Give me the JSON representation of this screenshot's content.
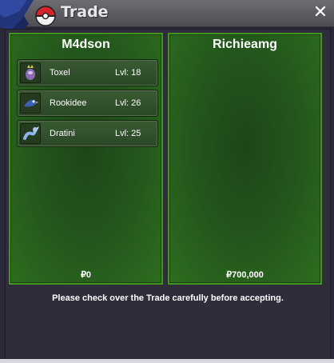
{
  "window": {
    "title": "Trade",
    "close_glyph": "✕"
  },
  "left_panel": {
    "player": "M4dson",
    "money": "₽0",
    "pokemon": [
      {
        "name": "Toxel",
        "level": "Lvl: 18",
        "icon": "toxel-icon"
      },
      {
        "name": "Rookidee",
        "level": "Lvl: 26",
        "icon": "rookidee-icon"
      },
      {
        "name": "Dratini",
        "level": "Lvl: 25",
        "icon": "dratini-icon"
      }
    ]
  },
  "right_panel": {
    "player": "Richieamg",
    "money": "₽700,000"
  },
  "notice": "Please check over the Trade carefully before accepting.",
  "colors": {
    "panel_border": "#43951e",
    "panel_fill": "#24581c",
    "background": "#2f2c3c"
  }
}
